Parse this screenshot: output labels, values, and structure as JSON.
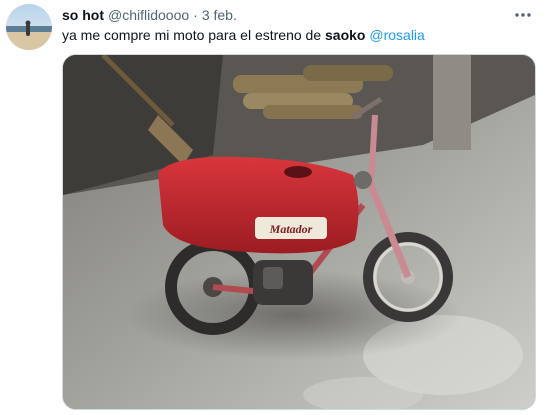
{
  "tweet": {
    "display_name": "so hot",
    "handle": "@chiflidoooo",
    "separator": "·",
    "date": "3 feb.",
    "text_before": "ya me compre mi moto para el estreno de ",
    "text_bold": "saoko",
    "text_space": " ",
    "mention": "@rosalia",
    "decal_text": "Matador"
  },
  "icons": {
    "more": "more-horizontal-icon"
  },
  "colors": {
    "mention": "#1d9bf0",
    "secondary_text": "#536471",
    "primary_text": "#0f1419",
    "border": "#cfd9de",
    "bike_red": "#c8232c"
  }
}
